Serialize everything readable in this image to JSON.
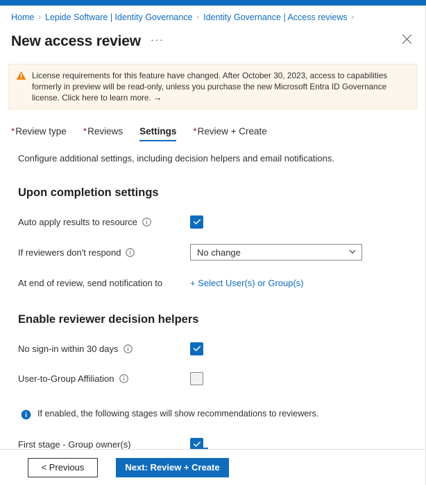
{
  "theme": {
    "accent": "#0f6cbd",
    "warning_bg": "#fdf6ec",
    "warning_icon": "#d83b01",
    "required_asterisk": "#a4262c",
    "link": "#0f6cbd",
    "text": "#323130"
  },
  "breadcrumb": {
    "items": [
      {
        "label": "Home"
      },
      {
        "label": "Lepide Software | Identity Governance"
      },
      {
        "label": "Identity Governance | Access reviews"
      }
    ],
    "separator": "›"
  },
  "header": {
    "title": "New access review",
    "more_label": "···",
    "close_icon": "close-icon"
  },
  "banner": {
    "icon": "warning-triangle-icon",
    "text": "License requirements for this feature have changed. After October 30, 2023, access to capabilities formerly in preview will be read-only, unless you purchase the new Microsoft Entra ID Governance license. Click here to learn more.",
    "arrow": "→"
  },
  "tabs": [
    {
      "label": "Review type",
      "required": true,
      "active": false
    },
    {
      "label": "Reviews",
      "required": true,
      "active": false
    },
    {
      "label": "Settings",
      "required": false,
      "active": true
    },
    {
      "label": "Review + Create",
      "required": true,
      "active": false
    }
  ],
  "main": {
    "intro": "Configure additional settings, including decision helpers and email notifications.",
    "sections": [
      {
        "title": "Upon completion settings",
        "rows": [
          {
            "label": "Auto apply results to resource",
            "info": true,
            "control": "checkbox",
            "checked": true
          },
          {
            "label": "If reviewers don't respond",
            "info": true,
            "control": "dropdown",
            "value": "No change"
          },
          {
            "label": "At end of review, send notification to",
            "info": false,
            "control": "link",
            "link_label": "+ Select User(s) or Group(s)"
          }
        ]
      },
      {
        "title": "Enable reviewer decision helpers",
        "rows": [
          {
            "label": "No sign-in within 30 days",
            "info": true,
            "control": "checkbox",
            "checked": true
          },
          {
            "label": "User-to-Group Affiliation",
            "info": true,
            "control": "checkbox",
            "checked": false
          }
        ],
        "info_message": "If enabled, the following stages will show recommendations to reviewers.",
        "stage_rows": [
          {
            "label": "First stage - Group owner(s)",
            "info": false,
            "control": "checkbox",
            "checked": true
          }
        ]
      }
    ]
  },
  "footer": {
    "previous_label": "< Previous",
    "next_label": "Next: Review + Create"
  }
}
